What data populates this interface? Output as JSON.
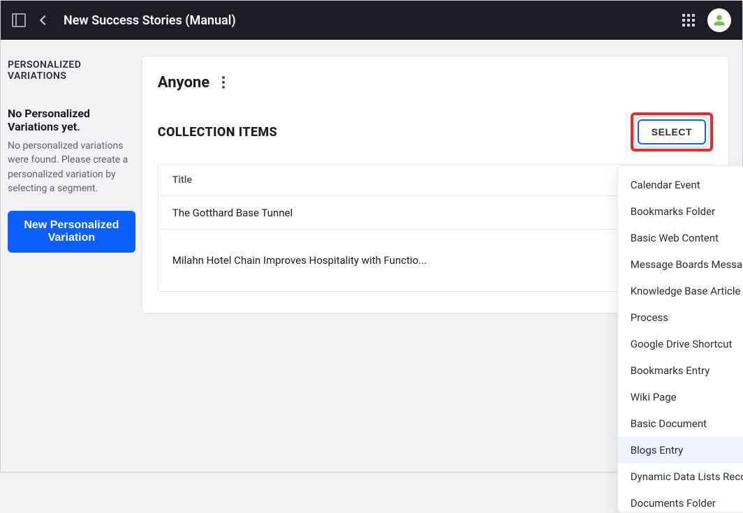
{
  "header": {
    "title": "New Success Stories (Manual)"
  },
  "sidebar": {
    "heading": "PERSONALIZED VARIATIONS",
    "empty_title": "No Personalized Variations yet.",
    "empty_desc": "No personalized variations were found. Please create a personalized variation by selecting a segment.",
    "new_button": "New Personalized Variation"
  },
  "main": {
    "audience": "Anyone",
    "section_title": "COLLECTION ITEMS",
    "select_button": "SELECT",
    "table": {
      "header_title": "Title",
      "rows": [
        {
          "title": "The Gotthard Base Tunnel"
        },
        {
          "title": "Milahn Hotel Chain Improves Hospitality with Functio..."
        }
      ]
    }
  },
  "dropdown": {
    "options": [
      "Calendar Event",
      "Bookmarks Folder",
      "Basic Web Content",
      "Message Boards Message",
      "Knowledge Base Article",
      "Process",
      "Google Drive Shortcut",
      "Bookmarks Entry",
      "Wiki Page",
      "Basic Document",
      "Blogs Entry",
      "Dynamic Data Lists Record",
      "Documents Folder"
    ],
    "active_index": 10
  }
}
